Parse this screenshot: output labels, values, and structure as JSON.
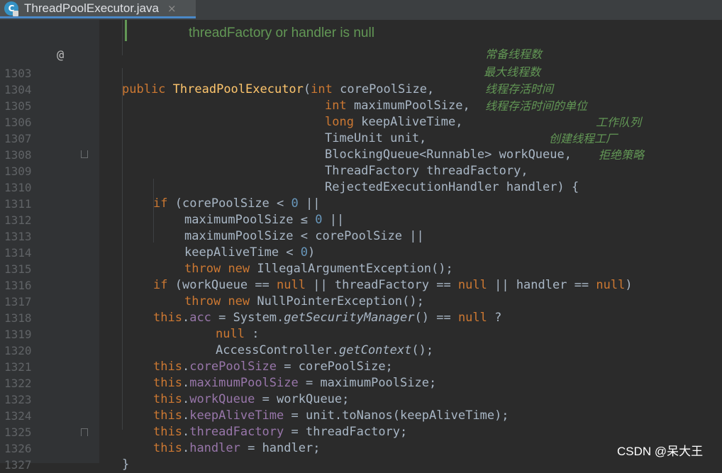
{
  "tab": {
    "icon_letter": "C",
    "title": "ThreadPoolExecutor.java",
    "close": "×"
  },
  "doc_comment": "threadFactory or handler is null",
  "gutter_marker": "@",
  "lines": [
    {
      "n": "1303"
    },
    {
      "n": "1304"
    },
    {
      "n": "1305"
    },
    {
      "n": "1306"
    },
    {
      "n": "1307"
    },
    {
      "n": "1308"
    },
    {
      "n": "1309"
    },
    {
      "n": "1310"
    },
    {
      "n": "1311"
    },
    {
      "n": "1312"
    },
    {
      "n": "1313"
    },
    {
      "n": "1314"
    },
    {
      "n": "1315"
    },
    {
      "n": "1316"
    },
    {
      "n": "1317"
    },
    {
      "n": "1318"
    },
    {
      "n": "1319"
    },
    {
      "n": "1320"
    },
    {
      "n": "1321"
    },
    {
      "n": "1322"
    },
    {
      "n": "1323"
    },
    {
      "n": "1324"
    },
    {
      "n": "1325"
    },
    {
      "n": "1326"
    },
    {
      "n": "1327"
    }
  ],
  "code": {
    "public": "public",
    "ctor": "ThreadPoolExecutor",
    "p1_open": "(",
    "int": "int",
    "corePoolSize": "corePoolSize,",
    "maximumPoolSize": "maximumPoolSize,",
    "long": "long",
    "keepAliveTime": "keepAliveTime,",
    "timeunit": "TimeUnit unit,",
    "blockingQueue": "BlockingQueue<Runnable> workQueue,",
    "threadFactoryParam": "ThreadFactory threadFactory,",
    "rejected": "RejectedExecutionHandler handler) {",
    "if": "if",
    "l1310_rest": "(corePoolSize < ",
    "zero": "0",
    "or": " ||",
    "l1311": "maximumPoolSize ≤ ",
    "l1312": "maximumPoolSize < corePoolSize ||",
    "l1313a": "keepAliveTime < ",
    "l1313b": ")",
    "throw": "throw",
    "new": "new",
    "iae": "IllegalArgumentException();",
    "l1315a": "(workQueue == ",
    "null": "null",
    "l1315b": " || threadFactory == ",
    "l1315c": " || handler == ",
    "l1315d": ")",
    "npe": "NullPointerException();",
    "this": "this",
    "dot": ".",
    "acc": "acc",
    "l1317a": " = System.",
    "getSecurityManager": "getSecurityManager",
    "l1317b": "() == ",
    "l1317c": " ?",
    "l1318b": " :",
    "l1319a": "AccessController.",
    "getContext": "getContext",
    "l1319b": "();",
    "f_core": "corePoolSize",
    "a_core": " = corePoolSize;",
    "f_max": "maximumPoolSize",
    "a_max": " = maximumPoolSize;",
    "f_wq": "workQueue",
    "a_wq": " = workQueue;",
    "f_kat": "keepAliveTime",
    "a_kat": " = unit.toNanos(keepAliveTime);",
    "f_tf": "threadFactory",
    "a_tf": " = threadFactory;",
    "f_h": "handler",
    "a_h": " = handler;",
    "close_brace": "}"
  },
  "comments": {
    "c1303": "常备线程数",
    "c1304": "最大线程数",
    "c1305": "线程存活时间",
    "c1306": "线程存活时间的单位",
    "c1307": "工作队列",
    "c1308": "创建线程工厂",
    "c1309": "拒绝策略"
  },
  "watermark": "CSDN @呆大王",
  "colors": {
    "background": "#2b2b2b",
    "keyword": "#cc7832",
    "method_decl": "#ffc66d",
    "number": "#6897bb",
    "field": "#9876aa",
    "comment": "#629755",
    "text": "#a9b7c6"
  }
}
